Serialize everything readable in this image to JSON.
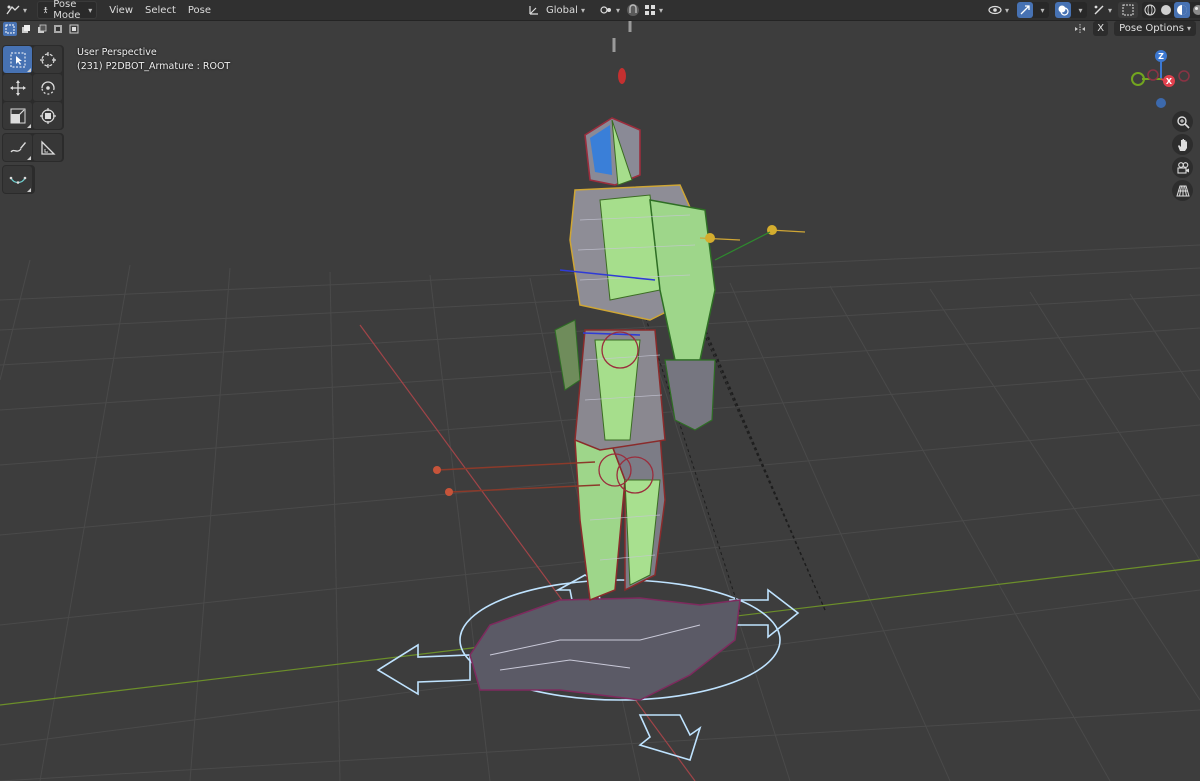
{
  "header": {
    "mode_label": "Pose Mode",
    "menus": [
      "View",
      "Select",
      "Pose"
    ],
    "orientation_label": "Global"
  },
  "overlay": {
    "perspective": "User Perspective",
    "object_info": "(231) P2DBOT_Armature : ROOT"
  },
  "right_tools": {
    "pose_options_label": "Pose Options",
    "x_label": "X"
  },
  "gizmo": {
    "z_label": "Z",
    "x_label": "X",
    "colors": {
      "x": "#e2414e",
      "y": "#72a51f",
      "z": "#3c78d1"
    }
  },
  "icons": [
    "editor-type-icon",
    "pose-mode-icon",
    "transform-orientation-icon",
    "pivot-icon",
    "snap-icon",
    "proportional-icon",
    "visibility-icon",
    "gizmo-icon",
    "overlay-icon",
    "xray-icon",
    "shading-icons",
    "zoom-icon",
    "pan-hand-icon",
    "camera-icon",
    "grid-icon",
    "select-box-icon",
    "cursor-icon",
    "move-icon",
    "rotate-icon",
    "scale-icon",
    "transform-icon",
    "annotate-icon",
    "measure-icon",
    "relax-icon"
  ],
  "theme": {
    "accent": "#4772b3",
    "background": "#3d3d3d"
  }
}
